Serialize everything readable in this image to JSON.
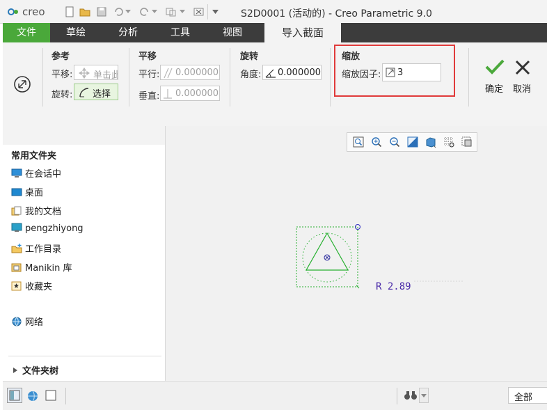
{
  "window": {
    "title": "S2D0001 (活动的) - Creo Parametric 9.0",
    "logo": "creo"
  },
  "ribbon_tabs": [
    "文件",
    "草绘",
    "分析",
    "工具",
    "视图",
    "导入截面"
  ],
  "ribbon": {
    "reference": {
      "title": "参考",
      "translate_label": "平移:",
      "translate_button": "单击此",
      "rotate_label": "旋转:",
      "rotate_button": "选择"
    },
    "translation": {
      "title": "平移",
      "parallel_label": "平行:",
      "parallel_value": "0.000000",
      "vertical_label": "垂直:",
      "vertical_value": "0.000000"
    },
    "rotation": {
      "title": "旋转",
      "angle_label": "角度:",
      "angle_value": "0.000000"
    },
    "scale": {
      "title": "缩放",
      "factor_label": "缩放因子:",
      "factor_value": "3"
    },
    "ok_label": "确定",
    "cancel_label": "取消"
  },
  "left_panel": {
    "section_title": "常用文件夹",
    "items": [
      {
        "label": "在会话中",
        "icon": "monitor-icon"
      },
      {
        "label": "桌面",
        "icon": "desktop-icon"
      },
      {
        "label": "我的文档",
        "icon": "documents-icon"
      },
      {
        "label": "pengzhiyong",
        "icon": "user-monitor-icon"
      },
      {
        "label": "工作目录",
        "icon": "working-folder-icon"
      },
      {
        "label": "Manikin 库",
        "icon": "library-icon"
      },
      {
        "label": "收藏夹",
        "icon": "favorites-icon"
      }
    ],
    "network_label": "网络",
    "folder_tree_label": "文件夹树"
  },
  "canvas": {
    "dimension_label": "R 2.89"
  },
  "status_bar": {
    "filter_value": "全部"
  }
}
